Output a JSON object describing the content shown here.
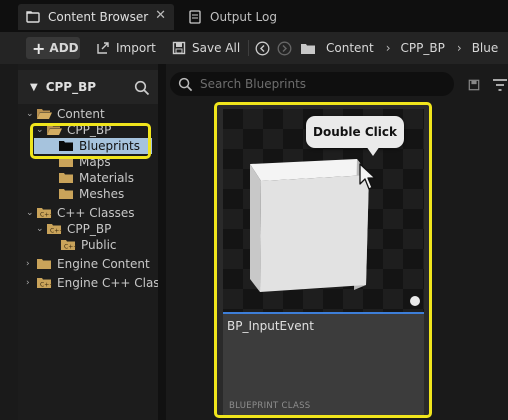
{
  "tabs": [
    {
      "label": "Content Browser",
      "icon": "folder-icon",
      "active": true
    },
    {
      "label": "Output Log",
      "icon": "output-log-icon",
      "active": false
    }
  ],
  "toolbar": {
    "add_label": "ADD",
    "import_label": "Import",
    "save_all_label": "Save All",
    "breadcrumb": [
      "Content",
      "CPP_BP",
      "Blue"
    ]
  },
  "left_panel": {
    "header": "CPP_BP",
    "tree": [
      {
        "label": "Content"
      },
      {
        "label": "CPP_BP"
      },
      {
        "label": "Blueprints",
        "selected": true
      },
      {
        "label": "Maps"
      },
      {
        "label": "Materials"
      },
      {
        "label": "Meshes"
      },
      {
        "label": "C++ Classes"
      },
      {
        "label": "CPP_BP"
      },
      {
        "label": "Public"
      },
      {
        "label": "Engine Content"
      },
      {
        "label": "Engine C++ Class"
      }
    ]
  },
  "search": {
    "placeholder": "Search Blueprints"
  },
  "asset": {
    "name": "BP_InputEvent",
    "type": "BLUEPRINT CLASS"
  },
  "callout": {
    "text": "Double Click"
  },
  "colors": {
    "highlight": "#f0e51c",
    "selection": "#a6c3dd",
    "folder": "#c9a35a",
    "accent_line": "#3d7ed8"
  }
}
